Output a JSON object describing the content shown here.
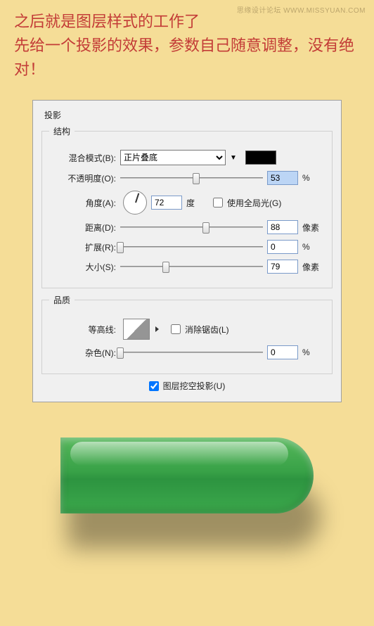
{
  "watermark": "思缘设计论坛  WWW.MISSYUAN.COM",
  "instructions": "之后就是图层样式的工作了\n先给一个投影的效果，参数自己随意调整，没有绝对！",
  "panel": {
    "title": "投影",
    "structureTitle": "结构",
    "qualityTitle": "品质",
    "blendMode": {
      "label": "混合模式(B):",
      "value": "正片叠底"
    },
    "opacity": {
      "label": "不透明度(O):",
      "value": "53",
      "pos": 53,
      "unit": "%"
    },
    "angle": {
      "label": "角度(A):",
      "value": "72",
      "unit": "度",
      "globalLabel": "使用全局光(G)",
      "globalChecked": false
    },
    "distance": {
      "label": "距离(D):",
      "value": "88",
      "pos": 60,
      "unit": "像素"
    },
    "spread": {
      "label": "扩展(R):",
      "value": "0",
      "pos": 0,
      "unit": "%"
    },
    "size": {
      "label": "大小(S):",
      "value": "79",
      "pos": 32,
      "unit": "像素"
    },
    "contour": {
      "label": "等高线:",
      "antiAliasLabel": "消除锯齿(L)",
      "antiAliasChecked": false
    },
    "noise": {
      "label": "杂色(N):",
      "value": "0",
      "pos": 0,
      "unit": "%"
    },
    "knockout": {
      "label": "图层挖空投影(U)",
      "checked": true
    }
  }
}
